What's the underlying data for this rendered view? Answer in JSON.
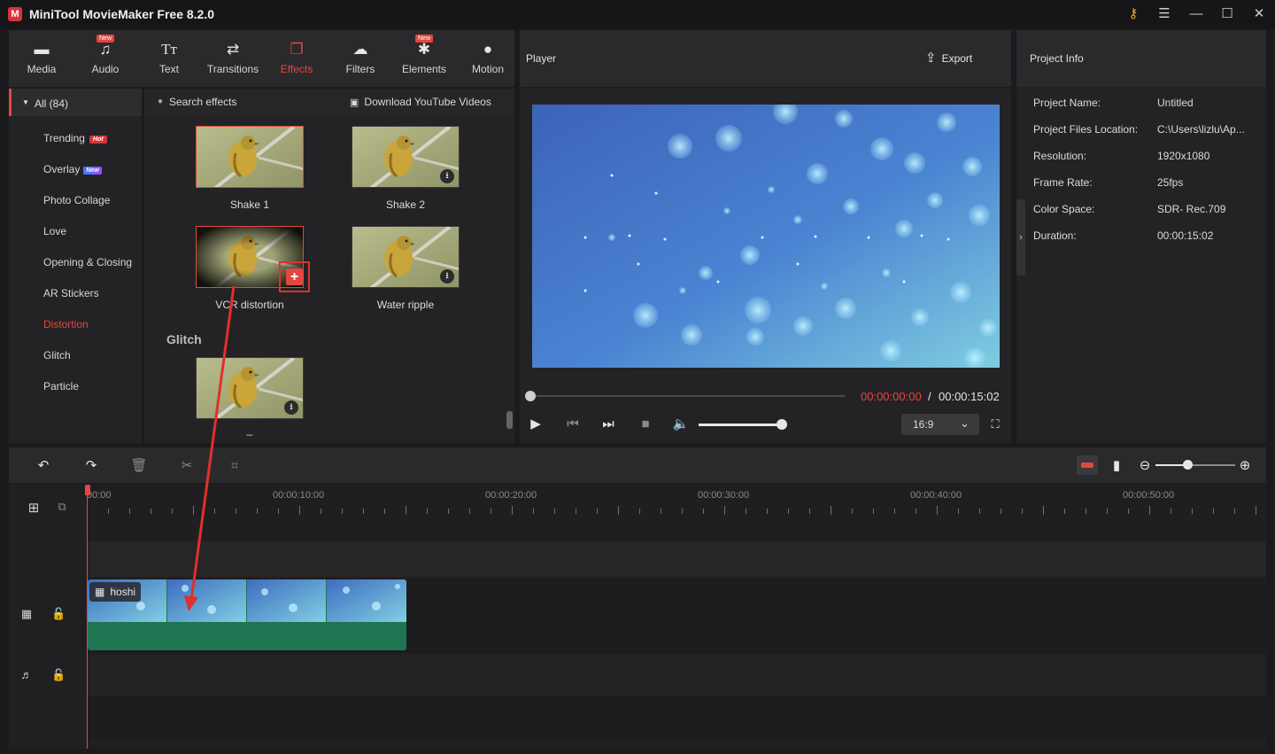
{
  "app": {
    "title": "MiniTool MovieMaker Free 8.2.0",
    "logo_letter": "M"
  },
  "window": {
    "key_icon": "key-icon",
    "menu_icon": "hamburger-icon",
    "min": "—",
    "max": "☐",
    "close": "✕"
  },
  "tabs": [
    {
      "label": "Media",
      "icon": "folder-icon",
      "new": false
    },
    {
      "label": "Audio",
      "icon": "music-icon",
      "new": true
    },
    {
      "label": "Text",
      "icon": "text-icon",
      "new": false
    },
    {
      "label": "Transitions",
      "icon": "transitions-icon",
      "new": false
    },
    {
      "label": "Effects",
      "icon": "effects-icon",
      "new": false,
      "active": true
    },
    {
      "label": "Filters",
      "icon": "filters-icon",
      "new": false
    },
    {
      "label": "Elements",
      "icon": "elements-icon",
      "new": true
    },
    {
      "label": "Motion",
      "icon": "motion-icon",
      "new": false
    }
  ],
  "new_badge": "New",
  "player": {
    "title": "Player",
    "export_label": "Export",
    "time_current": "00:00:00:00",
    "time_separator": " / ",
    "time_total": "00:00:15:02",
    "aspect_ratio": "16:9",
    "progress": 0,
    "volume": 0.94
  },
  "project_info": {
    "title": "Project Info",
    "rows": [
      {
        "label": "Project Name:",
        "value": "Untitled"
      },
      {
        "label": "Project Files Location:",
        "value": "C:\\Users\\lizlu\\Ap..."
      },
      {
        "label": "Resolution:",
        "value": "1920x1080"
      },
      {
        "label": "Frame Rate:",
        "value": "25fps"
      },
      {
        "label": "Color Space:",
        "value": "SDR- Rec.709"
      },
      {
        "label": "Duration:",
        "value": "00:00:15:02"
      }
    ]
  },
  "categories": {
    "all_label": "All (84)",
    "items": [
      {
        "label": "Trending",
        "badge": "Hot"
      },
      {
        "label": "Overlay",
        "badge": "New"
      },
      {
        "label": "Photo Collage"
      },
      {
        "label": "Love"
      },
      {
        "label": "Opening & Closing"
      },
      {
        "label": "AR Stickers"
      },
      {
        "label": "Distortion",
        "active": true
      },
      {
        "label": "Glitch"
      },
      {
        "label": "Particle"
      }
    ]
  },
  "effects": {
    "search_placeholder": "Search effects",
    "download_link": "Download YouTube Videos",
    "items": [
      {
        "label": "Shake 1",
        "selected": true
      },
      {
        "label": "Shake 2",
        "download": true
      },
      {
        "label": "VCR distortion",
        "add_button": true
      },
      {
        "label": "Water ripple",
        "download": true
      }
    ],
    "section_glitch": "Glitch",
    "glitch_partial_label": "–"
  },
  "timeline": {
    "ruler_labels": [
      "00:00",
      "00:00:10:00",
      "00:00:20:00",
      "00:00:30:00",
      "00:00:40:00",
      "00:00:50:00"
    ],
    "clip_label": "hoshi"
  },
  "colors": {
    "accent": "#e4473f",
    "panel": "#2a2a2d",
    "clip_green": "#1f7552",
    "background": "#1b1b1d"
  }
}
